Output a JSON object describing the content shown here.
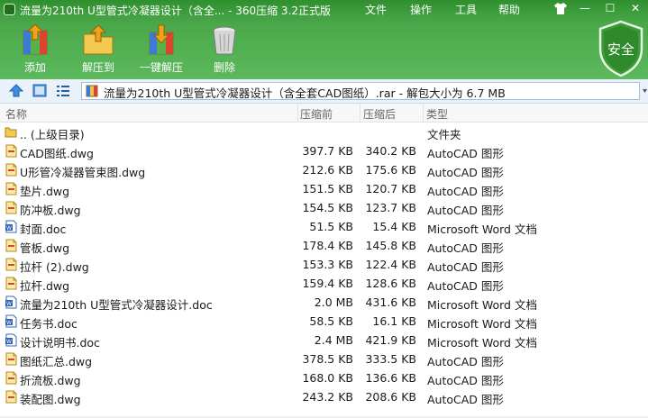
{
  "window": {
    "title": "流量为210th U型管式冷凝器设计（含全... - 360压缩 3.2正式版",
    "menu": [
      "文件",
      "操作",
      "工具",
      "帮助"
    ]
  },
  "toolbar": {
    "items": [
      {
        "label": "添加",
        "icon": "add-archive-icon"
      },
      {
        "label": "解压到",
        "icon": "extract-to-icon"
      },
      {
        "label": "一键解压",
        "icon": "one-click-extract-icon"
      },
      {
        "label": "删除",
        "icon": "trash-icon"
      }
    ],
    "security_label": "安全"
  },
  "address": {
    "path": "流量为210th U型管式冷凝器设计（含全套CAD图纸）.rar - 解包大小为 6.7 MB"
  },
  "columns": {
    "name": "名称",
    "size": "压缩前",
    "packed": "压缩后",
    "type": "类型"
  },
  "files": [
    {
      "name": ".. (上级目录)",
      "size": "",
      "packed": "",
      "type": "文件夹",
      "icon": "folder-icon"
    },
    {
      "name": "CAD图纸.dwg",
      "size": "397.7 KB",
      "packed": "340.2 KB",
      "type": "AutoCAD 图形",
      "icon": "dwg-file-icon"
    },
    {
      "name": "U形管冷凝器管束图.dwg",
      "size": "212.6 KB",
      "packed": "175.6 KB",
      "type": "AutoCAD 图形",
      "icon": "dwg-file-icon"
    },
    {
      "name": "垫片.dwg",
      "size": "151.5 KB",
      "packed": "120.7 KB",
      "type": "AutoCAD 图形",
      "icon": "dwg-file-icon"
    },
    {
      "name": "防冲板.dwg",
      "size": "154.5 KB",
      "packed": "123.7 KB",
      "type": "AutoCAD 图形",
      "icon": "dwg-file-icon"
    },
    {
      "name": "封面.doc",
      "size": "51.5 KB",
      "packed": "15.4 KB",
      "type": "Microsoft Word 文档",
      "icon": "doc-file-icon"
    },
    {
      "name": "管板.dwg",
      "size": "178.4 KB",
      "packed": "145.8 KB",
      "type": "AutoCAD 图形",
      "icon": "dwg-file-icon"
    },
    {
      "name": "拉杆 (2).dwg",
      "size": "153.3 KB",
      "packed": "122.4 KB",
      "type": "AutoCAD 图形",
      "icon": "dwg-file-icon"
    },
    {
      "name": "拉杆.dwg",
      "size": "159.4 KB",
      "packed": "128.6 KB",
      "type": "AutoCAD 图形",
      "icon": "dwg-file-icon"
    },
    {
      "name": "流量为210th U型管式冷凝器设计.doc",
      "size": "2.0 MB",
      "packed": "431.6 KB",
      "type": "Microsoft Word 文档",
      "icon": "doc-file-icon"
    },
    {
      "name": "任务书.doc",
      "size": "58.5 KB",
      "packed": "16.1 KB",
      "type": "Microsoft Word 文档",
      "icon": "doc-file-icon"
    },
    {
      "name": "设计说明书.doc",
      "size": "2.4 MB",
      "packed": "421.9 KB",
      "type": "Microsoft Word 文档",
      "icon": "doc-file-icon"
    },
    {
      "name": "图纸汇总.dwg",
      "size": "378.5 KB",
      "packed": "333.5 KB",
      "type": "AutoCAD 图形",
      "icon": "dwg-file-icon"
    },
    {
      "name": "折流板.dwg",
      "size": "168.0 KB",
      "packed": "136.6 KB",
      "type": "AutoCAD 图形",
      "icon": "dwg-file-icon"
    },
    {
      "name": "装配图.dwg",
      "size": "243.2 KB",
      "packed": "208.6 KB",
      "type": "AutoCAD 图形",
      "icon": "dwg-file-icon"
    }
  ]
}
